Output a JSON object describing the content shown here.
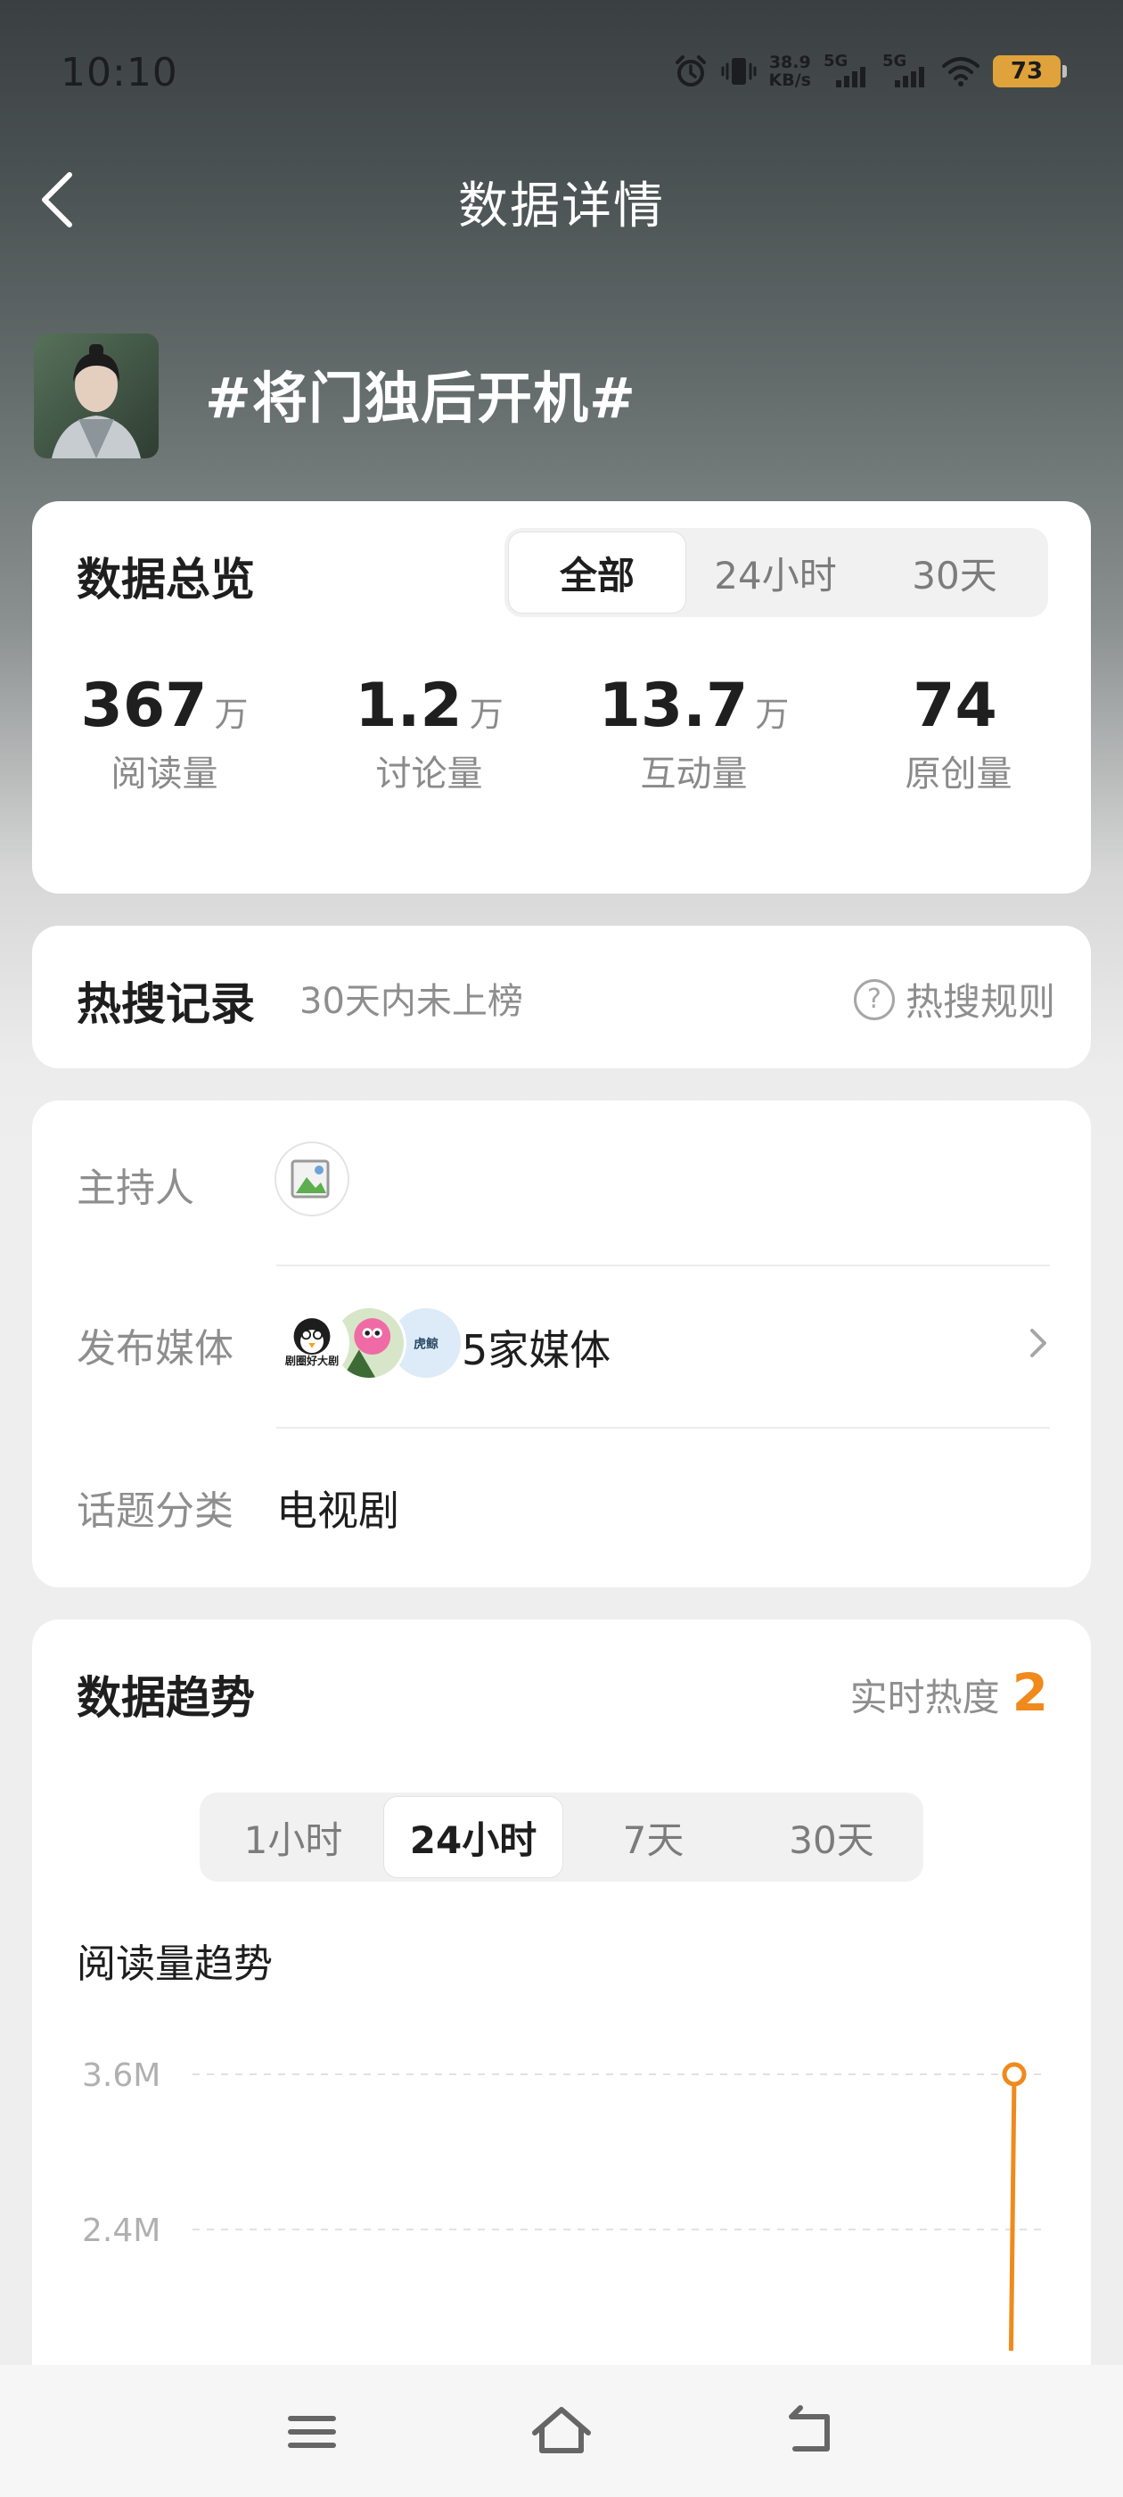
{
  "status_bar": {
    "time": "10:10",
    "net_speed_value": "38.9",
    "net_speed_unit": "KB/s",
    "signal1_label": "5G",
    "signal2_label": "5G",
    "battery": "73",
    "icons": [
      "alarm-icon",
      "vibrate-icon",
      "signal-icon",
      "signal-icon",
      "wifi-icon",
      "battery-icon"
    ]
  },
  "header": {
    "title": "数据详情",
    "back_icon": "chevron-left-icon"
  },
  "topic": {
    "title": "#将门独后开机#"
  },
  "overview": {
    "title": "数据总览",
    "tabs": [
      {
        "label": "全部",
        "active": true
      },
      {
        "label": "24小时",
        "active": false
      },
      {
        "label": "30天",
        "active": false
      }
    ],
    "stats": [
      {
        "value": "367",
        "unit": "万",
        "label": "阅读量"
      },
      {
        "value": "1.2",
        "unit": "万",
        "label": "讨论量"
      },
      {
        "value": "13.7",
        "unit": "万",
        "label": "互动量"
      },
      {
        "value": "74",
        "unit": "",
        "label": "原创量"
      }
    ]
  },
  "hot_search": {
    "title": "热搜记录",
    "subtitle": "30天内未上榜",
    "rules_label": "热搜规则"
  },
  "info": {
    "host_label": "主持人",
    "media_label": "发布媒体",
    "media_count": "5家媒体",
    "media_logo_1": "剧圈好大剧",
    "media_logo_3": "虎鲸",
    "category_label": "话题分类",
    "category_value": "电视剧"
  },
  "trend": {
    "title": "数据趋势",
    "realtime_label": "实时热度",
    "realtime_value": "2",
    "tabs": [
      {
        "label": "1小时",
        "active": false
      },
      {
        "label": "24小时",
        "active": true
      },
      {
        "label": "7天",
        "active": false
      },
      {
        "label": "30天",
        "active": false
      }
    ],
    "chart_title": "阅读量趋势"
  },
  "chart_data": {
    "type": "line",
    "title": "阅读量趋势",
    "xlabel": "",
    "ylabel": "",
    "y_ticks": [
      "3.6M",
      "2.4M"
    ],
    "ylim": [
      1200000,
      3600000
    ],
    "grid": true,
    "color": "#f08a1c",
    "series": [
      {
        "values": [
          1200000,
          3600000
        ]
      }
    ]
  },
  "nav": {
    "icons": [
      "menu-icon",
      "home-icon",
      "back-icon"
    ]
  },
  "colors": {
    "accent": "#f08a1c",
    "card": "#ffffff",
    "text": "#1e1e1e",
    "muted": "#8e8e8e"
  }
}
